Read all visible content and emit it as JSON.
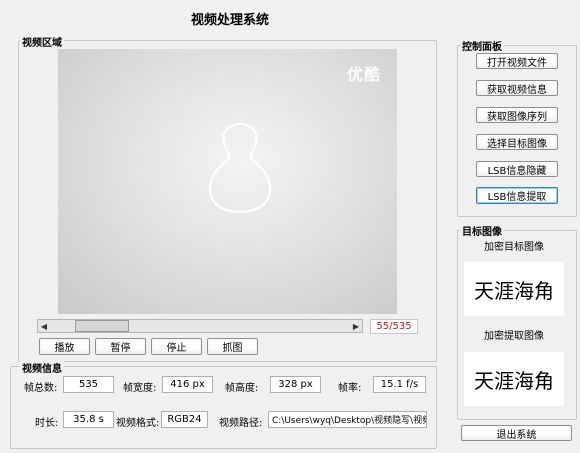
{
  "window": {
    "title": "视频处理系统"
  },
  "video_area": {
    "group_label": "视频区域",
    "watermark": "优酷",
    "frame_counter": "55/535",
    "progress": 0.1,
    "buttons": {
      "play": "播放",
      "pause": "暂停",
      "stop": "停止",
      "capture": "抓图"
    }
  },
  "control_panel": {
    "group_label": "控制面板",
    "buttons": {
      "open_video": "打开视频文件",
      "get_video_info": "获取视频信息",
      "get_image_sequence": "获取图像序列",
      "select_target": "选择目标图像",
      "lsb_hide": "LSB信息隐藏",
      "lsb_extract": "LSB信息提取"
    }
  },
  "target_image": {
    "group_label": "目标图像",
    "encrypt_label": "加密目标图像",
    "encrypt_text": "天涯海角",
    "extract_label": "加密提取图像",
    "extract_text": "天涯海角"
  },
  "video_info": {
    "group_label": "视频信息",
    "total_frames_label": "帧总数:",
    "total_frames": "535",
    "frame_width_label": "帧宽度:",
    "frame_width": "416 px",
    "frame_height_label": "帧高度:",
    "frame_height": "328 px",
    "frame_rate_label": "帧率:",
    "frame_rate": "15.1 f/s",
    "duration_label": "时长:",
    "duration": "35.8 s",
    "format_label": "视频格式:",
    "format": "RGB24",
    "path_label": "视频路径:",
    "path": "C:\\Users\\wyq\\Desktop\\视频隐写\\视频"
  },
  "exit_button": "退出系统"
}
